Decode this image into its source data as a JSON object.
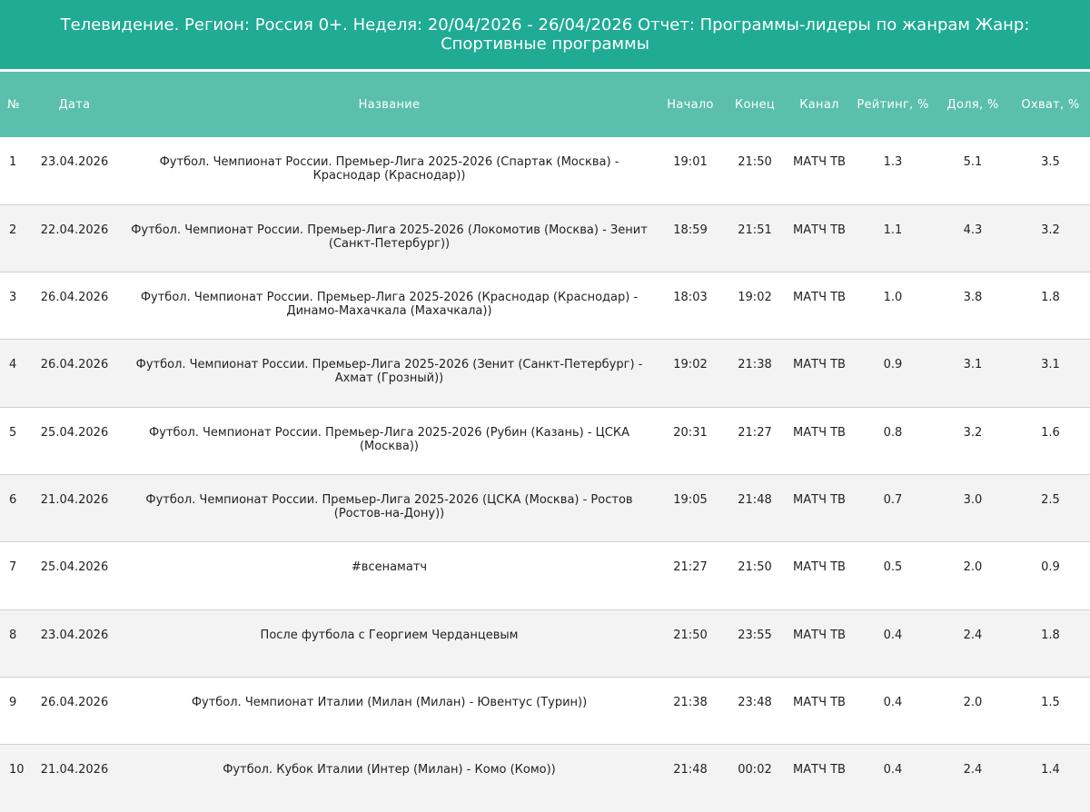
{
  "report": {
    "title": "Телевидение. Регион: Россия 0+. Неделя: 20/04/2026 - 26/04/2026 Отчет: Программы-лидеры по жанрам Жанр: Спортивные программы"
  },
  "table": {
    "headers": {
      "num": "№",
      "date": "Дата",
      "name": "Название",
      "start": "Начало",
      "end": "Конец",
      "channel": "Канал",
      "rating": "Рейтинг, %",
      "share": "Доля, %",
      "reach": "Охват, %"
    },
    "rows": [
      {
        "num": "1",
        "date": "23.04.2026",
        "name": "Футбол. Чемпионат России. Премьер-Лига 2025-2026 (Спартак (Москва) - Краснодар (Краснодар))",
        "start": "19:01",
        "end": "21:50",
        "channel": "МАТЧ ТВ",
        "rating": "1.3",
        "share": "5.1",
        "reach": "3.5"
      },
      {
        "num": "2",
        "date": "22.04.2026",
        "name": "Футбол. Чемпионат России. Премьер-Лига 2025-2026 (Локомотив (Москва) - Зенит (Санкт-Петербург))",
        "start": "18:59",
        "end": "21:51",
        "channel": "МАТЧ ТВ",
        "rating": "1.1",
        "share": "4.3",
        "reach": "3.2"
      },
      {
        "num": "3",
        "date": "26.04.2026",
        "name": "Футбол. Чемпионат России. Премьер-Лига 2025-2026 (Краснодар (Краснодар) - Динамо-Махачкала (Махачкала))",
        "start": "18:03",
        "end": "19:02",
        "channel": "МАТЧ ТВ",
        "rating": "1.0",
        "share": "3.8",
        "reach": "1.8"
      },
      {
        "num": "4",
        "date": "26.04.2026",
        "name": "Футбол. Чемпионат России. Премьер-Лига 2025-2026 (Зенит (Санкт-Петербург) - Ахмат (Грозный))",
        "start": "19:02",
        "end": "21:38",
        "channel": "МАТЧ ТВ",
        "rating": "0.9",
        "share": "3.1",
        "reach": "3.1"
      },
      {
        "num": "5",
        "date": "25.04.2026",
        "name": "Футбол. Чемпионат России. Премьер-Лига 2025-2026 (Рубин (Казань) - ЦСКА (Москва))",
        "start": "20:31",
        "end": "21:27",
        "channel": "МАТЧ ТВ",
        "rating": "0.8",
        "share": "3.2",
        "reach": "1.6"
      },
      {
        "num": "6",
        "date": "21.04.2026",
        "name": "Футбол. Чемпионат России. Премьер-Лига 2025-2026 (ЦСКА (Москва) - Ростов (Ростов-на-Дону))",
        "start": "19:05",
        "end": "21:48",
        "channel": "МАТЧ ТВ",
        "rating": "0.7",
        "share": "3.0",
        "reach": "2.5"
      },
      {
        "num": "7",
        "date": "25.04.2026",
        "name": "#всенаматч",
        "start": "21:27",
        "end": "21:50",
        "channel": "МАТЧ ТВ",
        "rating": "0.5",
        "share": "2.0",
        "reach": "0.9"
      },
      {
        "num": "8",
        "date": "23.04.2026",
        "name": "После футбола с Георгием Черданцевым",
        "start": "21:50",
        "end": "23:55",
        "channel": "МАТЧ ТВ",
        "rating": "0.4",
        "share": "2.4",
        "reach": "1.8"
      },
      {
        "num": "9",
        "date": "26.04.2026",
        "name": "Футбол. Чемпионат Италии (Милан (Милан) - Ювентус (Турин))",
        "start": "21:38",
        "end": "23:48",
        "channel": "МАТЧ ТВ",
        "rating": "0.4",
        "share": "2.0",
        "reach": "1.5"
      },
      {
        "num": "10",
        "date": "21.04.2026",
        "name": "Футбол. Кубок Италии (Интер (Милан) - Комо (Комо))",
        "start": "21:48",
        "end": "00:02",
        "channel": "МАТЧ ТВ",
        "rating": "0.4",
        "share": "2.4",
        "reach": "1.4"
      }
    ]
  }
}
